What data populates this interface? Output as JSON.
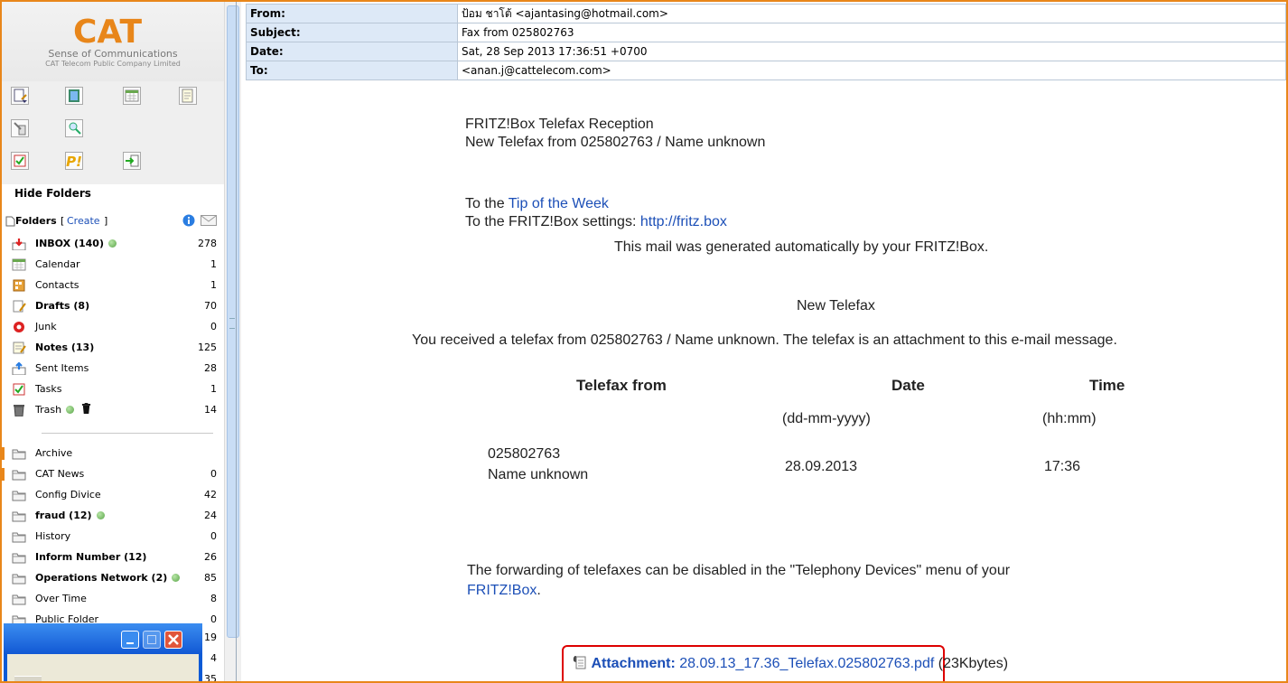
{
  "brand": {
    "logo_text": "CAT",
    "tagline": "Sense of Communications",
    "company": "CAT Telecom Public Company Limited",
    "color": "#e8861a"
  },
  "sidebar": {
    "hide_folders": "Hide Folders",
    "folders_label": "Folders",
    "create_label": "Create",
    "create_brackets": [
      "[",
      "]"
    ],
    "folders": [
      {
        "name": "INBOX (140)",
        "count": "278",
        "bold": true,
        "dot": true,
        "icon": "inbox-icon"
      },
      {
        "name": "Calendar",
        "count": "1",
        "bold": false,
        "icon": "calendar-icon"
      },
      {
        "name": "Contacts",
        "count": "1",
        "bold": false,
        "icon": "contacts-icon"
      },
      {
        "name": "Drafts (8)",
        "count": "70",
        "bold": true,
        "icon": "drafts-icon"
      },
      {
        "name": "Junk",
        "count": "0",
        "bold": false,
        "icon": "junk-icon"
      },
      {
        "name": "Notes (13)",
        "count": "125",
        "bold": true,
        "icon": "notes-icon"
      },
      {
        "name": "Sent Items",
        "count": "28",
        "bold": false,
        "icon": "sent-icon"
      },
      {
        "name": "Tasks",
        "count": "1",
        "bold": false,
        "icon": "tasks-icon"
      },
      {
        "name": "Trash",
        "count": "14",
        "bold": false,
        "dot": true,
        "icon": "trash-icon"
      }
    ],
    "subfolders": [
      {
        "name": "Archive",
        "count": "",
        "bold": false
      },
      {
        "name": "CAT News",
        "count": "0",
        "bold": false
      },
      {
        "name": "Config Divice",
        "count": "42",
        "bold": false
      },
      {
        "name": "fraud (12)",
        "count": "24",
        "bold": true,
        "dot": true
      },
      {
        "name": "History",
        "count": "0",
        "bold": false
      },
      {
        "name": "Inform Number (12)",
        "count": "26",
        "bold": true
      },
      {
        "name": "Operations Network (2)",
        "count": "85",
        "bold": true,
        "dot": true
      },
      {
        "name": "Over Time",
        "count": "8",
        "bold": false
      },
      {
        "name": "Public Folder",
        "count": "0",
        "bold": false
      }
    ],
    "partial_counts": [
      "19",
      "4",
      "35"
    ]
  },
  "headers": [
    {
      "label": "From:",
      "value": "ป้อม ชาโต้ <ajantasing@hotmail.com>"
    },
    {
      "label": "Subject:",
      "value": "Fax from 025802763"
    },
    {
      "label": "Date:",
      "value": "Sat, 28 Sep 2013 17:36:51 +0700"
    },
    {
      "label": "To:",
      "value": "<anan.j@cattelecom.com>"
    }
  ],
  "message": {
    "line1": "FRITZ!Box Telefax Reception",
    "line2": "New Telefax from 025802763 / Name unknown",
    "to_the": "To the",
    "tip_link": "Tip of the Week",
    "settings_text": "To the FRITZ!Box settings:",
    "settings_link": "http://fritz.box",
    "auto_generated": "This mail was generated automatically by your FRITZ!Box.",
    "new_telefax": "New Telefax",
    "received": "You received a telefax from 025802763 / Name unknown. The telefax is an attachment to this e-mail message.",
    "table": {
      "col_from": "Telefax from",
      "col_date": "Date",
      "col_time": "Time",
      "date_format": "(dd-mm-yyyy)",
      "time_format": "(hh:mm)",
      "number": "025802763",
      "name": "Name unknown",
      "date": "28.09.2013",
      "time": "17:36"
    },
    "forwarding": "The forwarding of telefaxes can be disabled in the \"Telephony Devices\" menu of your",
    "fritz_link": "FRITZ!Box",
    "period": ".",
    "attachment_label": "Attachment:",
    "attachment_file": "28.09.13_17.36_Telefax.025802763.pdf",
    "attachment_size": "(23Kbytes)"
  }
}
